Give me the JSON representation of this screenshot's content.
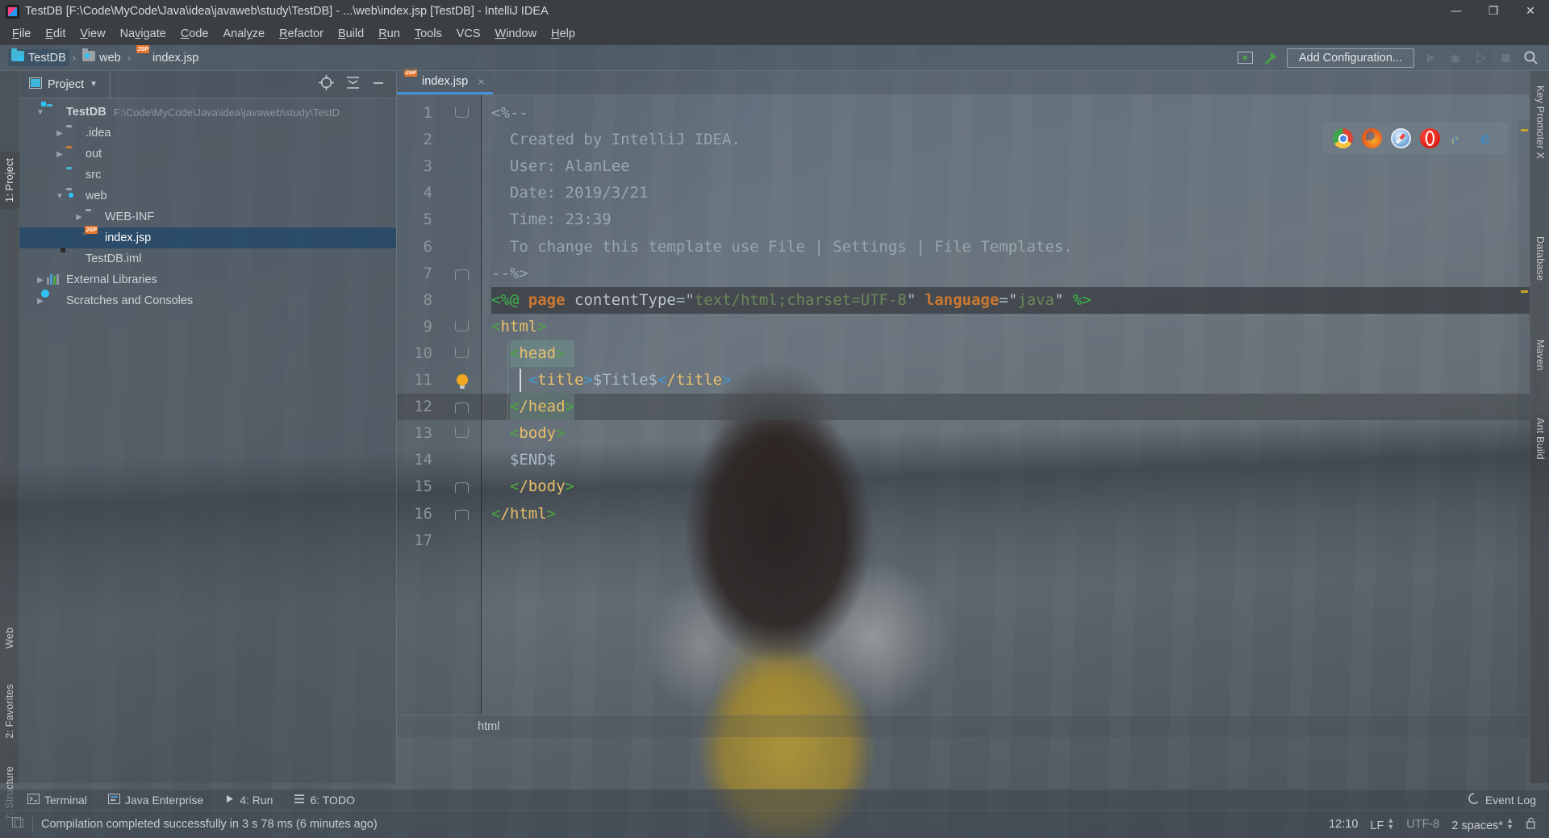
{
  "window": {
    "title": "TestDB [F:\\Code\\MyCode\\Java\\idea\\javaweb\\study\\TestDB] - ...\\web\\index.jsp [TestDB] - IntelliJ IDEA",
    "minimize": "—",
    "maximize": "❐",
    "close": "✕"
  },
  "menubar": {
    "items": [
      "File",
      "Edit",
      "View",
      "Navigate",
      "Code",
      "Analyze",
      "Refactor",
      "Build",
      "Run",
      "Tools",
      "VCS",
      "Window",
      "Help"
    ]
  },
  "navbar": {
    "crumbs": [
      "TestDB",
      "web",
      "index.jsp"
    ],
    "separator": "›",
    "add_configuration": "Add Configuration..."
  },
  "left_strip": {
    "project": "1: Project",
    "web": "Web",
    "favorites": "2: Favorites",
    "structure": "7: Structure"
  },
  "right_strip": {
    "items": [
      "Key Promoter X",
      "Database",
      "Maven",
      "Ant Build"
    ]
  },
  "project_panel": {
    "title": "Project",
    "tree": [
      {
        "label": "TestDB",
        "path": "F:\\Code\\MyCode\\Java\\idea\\javaweb\\study\\TestD",
        "indent": 0,
        "arrow": "▼",
        "icon": "module-folder",
        "bold": true,
        "selected": false
      },
      {
        "label": ".idea",
        "path": "",
        "indent": 1,
        "arrow": "▶",
        "icon": "folder",
        "bold": false,
        "selected": false
      },
      {
        "label": "out",
        "path": "",
        "indent": 1,
        "arrow": "▶",
        "icon": "folder-orange",
        "bold": false,
        "selected": false
      },
      {
        "label": "src",
        "path": "",
        "indent": 1,
        "arrow": "",
        "icon": "folder-cyan",
        "bold": false,
        "selected": false
      },
      {
        "label": "web",
        "path": "",
        "indent": 1,
        "arrow": "▼",
        "icon": "folder-web",
        "bold": false,
        "selected": false
      },
      {
        "label": "WEB-INF",
        "path": "",
        "indent": 2,
        "arrow": "▶",
        "icon": "folder",
        "bold": false,
        "selected": false
      },
      {
        "label": "index.jsp",
        "path": "",
        "indent": 2,
        "arrow": "",
        "icon": "jsp-file",
        "bold": false,
        "selected": true
      },
      {
        "label": "TestDB.iml",
        "path": "",
        "indent": 1,
        "arrow": "",
        "icon": "iml-file",
        "bold": false,
        "selected": false
      },
      {
        "label": "External Libraries",
        "path": "",
        "indent": 0,
        "arrow": "▶",
        "icon": "library",
        "bold": false,
        "selected": false
      },
      {
        "label": "Scratches and Consoles",
        "path": "",
        "indent": 0,
        "arrow": "▶",
        "icon": "scratch",
        "bold": false,
        "selected": false
      }
    ]
  },
  "editor": {
    "tab_label": "index.jsp",
    "tab_close": "×",
    "breadcrumb": "html",
    "current_line": 12,
    "lines": [
      {
        "n": 1,
        "fold": "open",
        "segments": [
          {
            "t": "<%--",
            "c": "c-comment"
          }
        ]
      },
      {
        "n": 2,
        "fold": "",
        "segments": [
          {
            "t": "  Created by IntelliJ IDEA.",
            "c": "c-comment"
          }
        ]
      },
      {
        "n": 3,
        "fold": "",
        "segments": [
          {
            "t": "  User: AlanLee",
            "c": "c-comment"
          }
        ]
      },
      {
        "n": 4,
        "fold": "",
        "segments": [
          {
            "t": "  Date: 2019/3/21",
            "c": "c-comment"
          }
        ]
      },
      {
        "n": 5,
        "fold": "",
        "segments": [
          {
            "t": "  Time: 23:39",
            "c": "c-comment"
          }
        ]
      },
      {
        "n": 6,
        "fold": "",
        "segments": [
          {
            "t": "  To change this template use File | Settings | File Templates.",
            "c": "c-comment"
          }
        ]
      },
      {
        "n": 7,
        "fold": "close",
        "segments": [
          {
            "t": "--%>",
            "c": "c-comment"
          }
        ]
      },
      {
        "n": 8,
        "fold": "",
        "segments": [
          {
            "t": "<%@",
            "c": "c-pct"
          },
          {
            "t": " ",
            "c": "c-txt"
          },
          {
            "t": "page",
            "c": "c-kw"
          },
          {
            "t": " ",
            "c": "c-txt"
          },
          {
            "t": "contentType",
            "c": "c-attr"
          },
          {
            "t": "=",
            "c": "c-txt"
          },
          {
            "t": "\"",
            "c": "c-txt"
          },
          {
            "t": "text/html;charset=UTF-8",
            "c": "c-str"
          },
          {
            "t": "\"",
            "c": "c-txt"
          },
          {
            "t": " ",
            "c": "c-txt"
          },
          {
            "t": "language",
            "c": "c-kw"
          },
          {
            "t": "=",
            "c": "c-txt"
          },
          {
            "t": "\"",
            "c": "c-txt"
          },
          {
            "t": "java",
            "c": "c-str"
          },
          {
            "t": "\"",
            "c": "c-txt"
          },
          {
            "t": " ",
            "c": "c-txt"
          },
          {
            "t": "%>",
            "c": "c-pct"
          }
        ]
      },
      {
        "n": 9,
        "fold": "open",
        "segments": [
          {
            "t": "<",
            "c": "c-brk"
          },
          {
            "t": "html",
            "c": "c-tag"
          },
          {
            "t": ">",
            "c": "c-brk"
          }
        ]
      },
      {
        "n": 10,
        "fold": "open",
        "segments": [
          {
            "t": "  ",
            "c": "c-txt"
          },
          {
            "t": "<",
            "c": "c-brk"
          },
          {
            "t": "head",
            "c": "c-tag"
          },
          {
            "t": ">",
            "c": "c-brk"
          }
        ]
      },
      {
        "n": 11,
        "fold": "bulb",
        "segments": [
          {
            "t": "    ",
            "c": "c-txt"
          },
          {
            "t": "<",
            "c": "c-brkb"
          },
          {
            "t": "title",
            "c": "c-tag"
          },
          {
            "t": ">",
            "c": "c-brkb"
          },
          {
            "t": "$Title$",
            "c": "c-txt"
          },
          {
            "t": "<",
            "c": "c-brkb"
          },
          {
            "t": "/title",
            "c": "c-tag"
          },
          {
            "t": ">",
            "c": "c-brkb"
          }
        ]
      },
      {
        "n": 12,
        "fold": "close",
        "segments": [
          {
            "t": "  ",
            "c": "c-txt"
          },
          {
            "t": "<",
            "c": "c-brk"
          },
          {
            "t": "/head",
            "c": "c-tag"
          },
          {
            "t": ">",
            "c": "c-brk"
          }
        ]
      },
      {
        "n": 13,
        "fold": "open",
        "segments": [
          {
            "t": "  ",
            "c": "c-txt"
          },
          {
            "t": "<",
            "c": "c-brk"
          },
          {
            "t": "body",
            "c": "c-tag"
          },
          {
            "t": ">",
            "c": "c-brk"
          }
        ]
      },
      {
        "n": 14,
        "fold": "",
        "segments": [
          {
            "t": "  $END$",
            "c": "c-txt"
          }
        ]
      },
      {
        "n": 15,
        "fold": "close",
        "segments": [
          {
            "t": "  ",
            "c": "c-txt"
          },
          {
            "t": "<",
            "c": "c-brk"
          },
          {
            "t": "/body",
            "c": "c-tag"
          },
          {
            "t": ">",
            "c": "c-brk"
          }
        ]
      },
      {
        "n": 16,
        "fold": "close",
        "segments": [
          {
            "t": "<",
            "c": "c-brk"
          },
          {
            "t": "/html",
            "c": "c-tag"
          },
          {
            "t": ">",
            "c": "c-brk"
          }
        ]
      },
      {
        "n": 17,
        "fold": "",
        "segments": []
      }
    ]
  },
  "browsers": [
    {
      "name": "chrome-icon"
    },
    {
      "name": "firefox-icon"
    },
    {
      "name": "safari-icon"
    },
    {
      "name": "opera-icon"
    },
    {
      "name": "internet-explorer-icon"
    },
    {
      "name": "edge-icon"
    }
  ],
  "toolwindow_bar": {
    "items": [
      "Terminal",
      "Java Enterprise",
      "4: Run",
      "6: TODO"
    ],
    "event_log": "Event Log"
  },
  "statusbar": {
    "message": "Compilation completed successfully in 3 s 78 ms (6 minutes ago)",
    "position": "12:10",
    "line_separator": "LF",
    "encoding": "UTF-8",
    "indent": "2 spaces*"
  },
  "colors": {
    "accent": "#4192d9",
    "selection": "#26496a",
    "keyword": "#cc7832",
    "string": "#6a8759",
    "tag": "#e8bf6a",
    "bracket": "#4aa63f"
  }
}
